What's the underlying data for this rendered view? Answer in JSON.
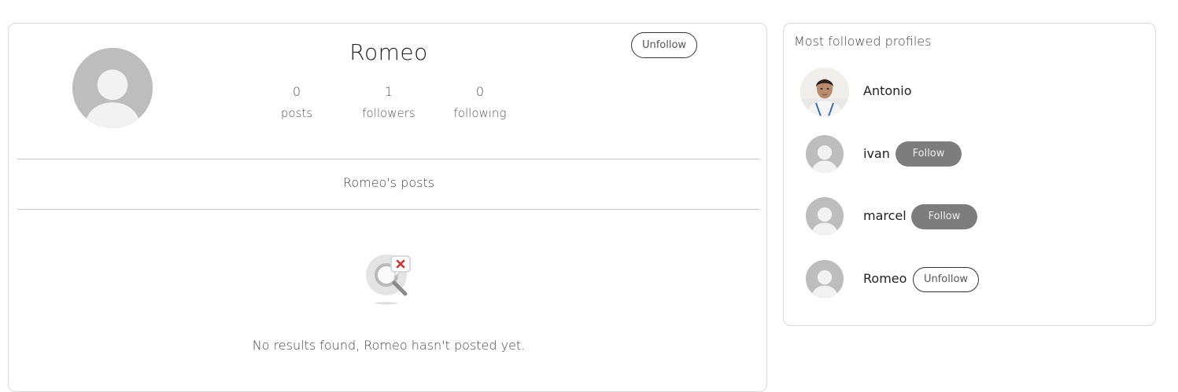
{
  "profile": {
    "username": "Romeo",
    "unfollow_label": "Unfollow",
    "stats": [
      {
        "value": "0",
        "label": "posts"
      },
      {
        "value": "1",
        "label": "followers"
      },
      {
        "value": "0",
        "label": "following"
      }
    ],
    "posts_title": "Romeo's posts",
    "empty_message": "No results found, Romeo hasn't posted yet.",
    "avatar_icon": "default-user-avatar",
    "empty_icon": "no-results-search-icon"
  },
  "sidebar": {
    "title": "Most followed profiles",
    "profiles": [
      {
        "name": "Antonio",
        "avatar": "user-photo",
        "button": ""
      },
      {
        "name": "ivan",
        "avatar": "default-user-avatar",
        "button": "Follow"
      },
      {
        "name": "marcel",
        "avatar": "default-user-avatar",
        "button": "Follow"
      },
      {
        "name": "Romeo",
        "avatar": "default-user-avatar",
        "button": "Unfollow"
      }
    ]
  },
  "colors": {
    "follow_button": "#7d7d7d",
    "avatar_placeholder": "#bdbdbd",
    "border": "#d9d9d9"
  }
}
